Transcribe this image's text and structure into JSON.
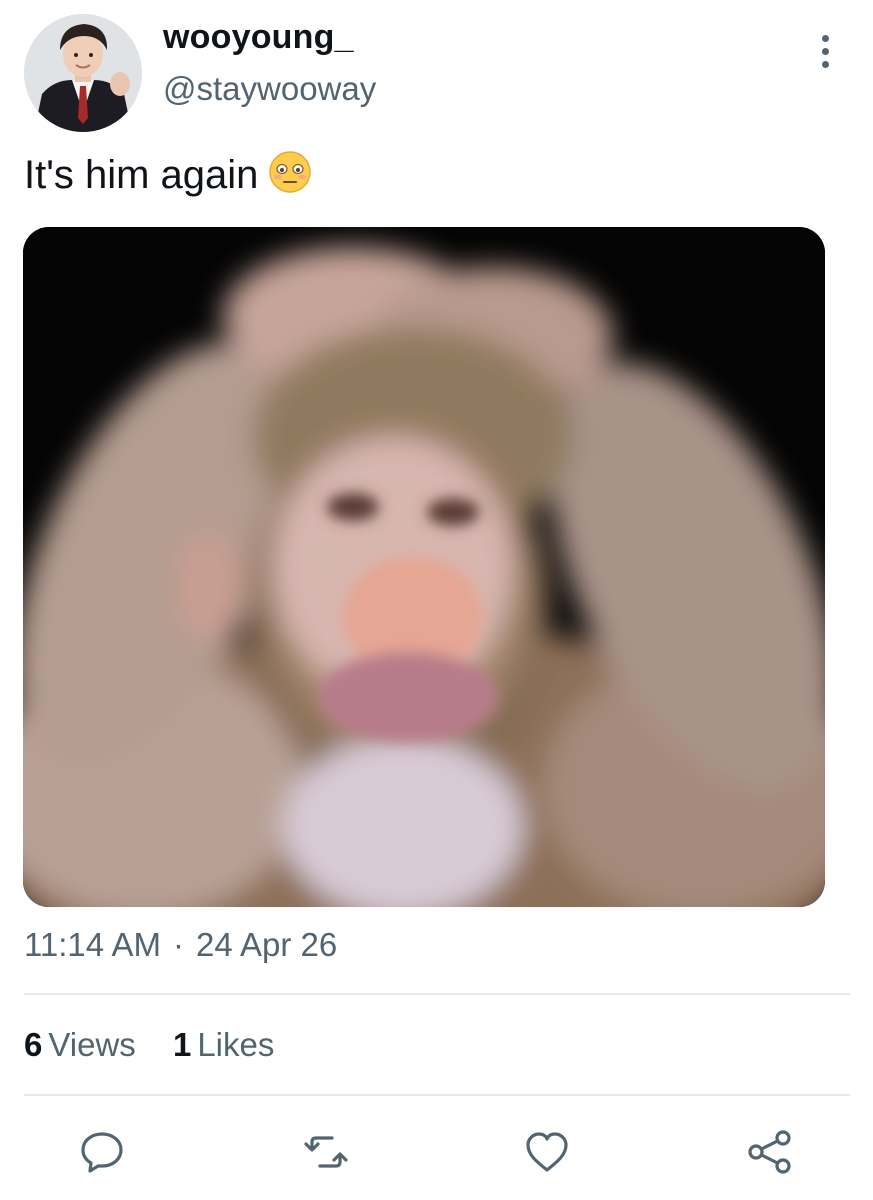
{
  "author": {
    "display_name": "wooyoung_",
    "handle": "@staywooway",
    "avatar_icon": "user-avatar-photo"
  },
  "tweet": {
    "text": "It's him again",
    "emoji_icon": "flushed-face-emoji",
    "media": {
      "description_icon": "blurry-monkey-photo"
    },
    "time": "11:14 AM",
    "separator": "·",
    "date": "24 Apr 26"
  },
  "stats": {
    "views_count": "6",
    "views_label": "Views",
    "likes_count": "1",
    "likes_label": "Likes"
  },
  "actions": [
    {
      "name": "reply",
      "icon": "comment-icon"
    },
    {
      "name": "retweet",
      "icon": "retweet-icon"
    },
    {
      "name": "like",
      "icon": "heart-icon"
    },
    {
      "name": "share",
      "icon": "share-icon"
    }
  ],
  "colors": {
    "primary_text": "#0f1419",
    "secondary_text": "#536471",
    "divider": "#e6e8ea",
    "background": "#ffffff"
  }
}
